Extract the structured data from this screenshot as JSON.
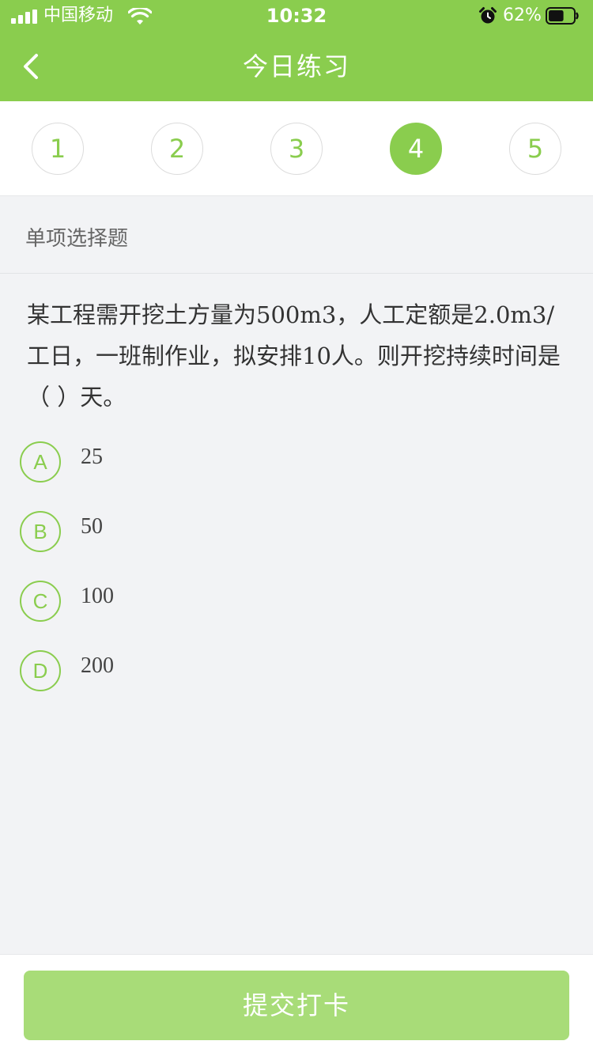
{
  "status_bar": {
    "carrier": "中国移动",
    "time": "10:32",
    "battery_percent": "62%",
    "battery_level": 0.62
  },
  "nav": {
    "title": "今日练习"
  },
  "steps": [
    {
      "label": "1",
      "active": false
    },
    {
      "label": "2",
      "active": false
    },
    {
      "label": "3",
      "active": false
    },
    {
      "label": "4",
      "active": true
    },
    {
      "label": "5",
      "active": false
    }
  ],
  "question": {
    "type_label": "单项选择题",
    "text": "某工程需开挖土方量为500m3，人工定额是2.0m3/工日，一班制作业，拟安排10人。则开挖持续时间是（ ）天。",
    "options": [
      {
        "letter": "A",
        "text": "25"
      },
      {
        "letter": "B",
        "text": "50"
      },
      {
        "letter": "C",
        "text": "100"
      },
      {
        "letter": "D",
        "text": "200"
      }
    ]
  },
  "footer": {
    "submit_label": "提交打卡"
  },
  "colors": {
    "accent": "#8acd4e",
    "accent_light": "#a8dc78",
    "background": "#f2f3f5"
  },
  "icons": {
    "signal": "signal-icon",
    "wifi": "wifi-icon",
    "alarm": "alarm-icon",
    "battery": "battery-icon",
    "back": "chevron-left-icon"
  }
}
